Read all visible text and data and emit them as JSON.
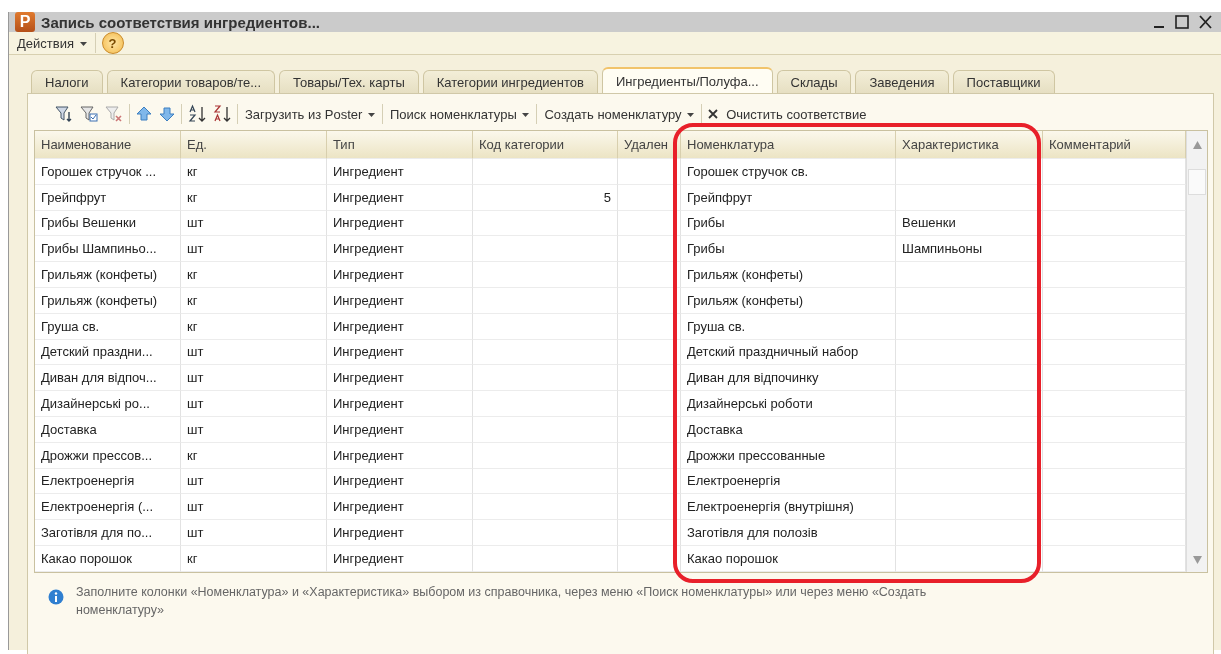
{
  "window": {
    "logo": "P",
    "title": "Запись соответствия ингредиентов..."
  },
  "menu": {
    "actions": "Действия",
    "help": "?"
  },
  "tabs": [
    {
      "label": "Налоги",
      "selected": false
    },
    {
      "label": "Категории товаров/те...",
      "selected": false
    },
    {
      "label": "Товары/Тех. карты",
      "selected": false
    },
    {
      "label": "Категории ингредиентов",
      "selected": false
    },
    {
      "label": "Ингредиенты/Полуфа...",
      "selected": true
    },
    {
      "label": "Склады",
      "selected": false
    },
    {
      "label": "Заведения",
      "selected": false
    },
    {
      "label": "Поставщики",
      "selected": false
    }
  ],
  "toolbar": {
    "load": "Загрузить из Poster",
    "search": "Поиск номенклатуры",
    "create": "Создать номенклатуру",
    "clear": "Очистить соответствие"
  },
  "table": {
    "columns": [
      "Наименование",
      "Ед.",
      "Тип",
      "Код категории",
      "Удален",
      "Номенклатура",
      "Характеристика",
      "Комментарий"
    ],
    "rows": [
      [
        "Горошек стручок ...",
        "кг",
        "Ингредиент",
        "",
        "",
        "Горошек стручок св.",
        "",
        ""
      ],
      [
        "Грейпфрут",
        "кг",
        "Ингредиент",
        "5",
        "",
        "Грейпфрут",
        "",
        ""
      ],
      [
        "Грибы Вешенки",
        "шт",
        "Ингредиент",
        "",
        "",
        "Грибы",
        "Вешенки",
        ""
      ],
      [
        "Грибы Шампиньо...",
        "шт",
        "Ингредиент",
        "",
        "",
        "Грибы",
        "Шампиньоны",
        ""
      ],
      [
        "Грильяж (конфеты)",
        "кг",
        "Ингредиент",
        "",
        "",
        "Грильяж (конфеты)",
        "",
        ""
      ],
      [
        "Грильяж (конфеты)",
        "кг",
        "Ингредиент",
        "",
        "",
        "Грильяж (конфеты)",
        "",
        ""
      ],
      [
        "Груша св.",
        "кг",
        "Ингредиент",
        "",
        "",
        "Груша св.",
        "",
        ""
      ],
      [
        "Детский праздни...",
        "шт",
        "Ингредиент",
        "",
        "",
        "Детский праздничный набор",
        "",
        ""
      ],
      [
        "Диван для відпоч...",
        "шт",
        "Ингредиент",
        "",
        "",
        "Диван для відпочинку",
        "",
        ""
      ],
      [
        "Дизайнерські ро...",
        "шт",
        "Ингредиент",
        "",
        "",
        "Дизайнерські роботи",
        "",
        ""
      ],
      [
        "Доставка",
        "шт",
        "Ингредиент",
        "",
        "",
        "Доставка",
        "",
        ""
      ],
      [
        "Дрожжи прессов...",
        "кг",
        "Ингредиент",
        "",
        "",
        "Дрожжи прессованные",
        "",
        ""
      ],
      [
        "Електроенергія",
        "шт",
        "Ингредиент",
        "",
        "",
        "Електроенергія",
        "",
        ""
      ],
      [
        "Електроенергія (...",
        "шт",
        "Ингредиент",
        "",
        "",
        "Електроенергія (внутрішня)",
        "",
        ""
      ],
      [
        "Заготівля для по...",
        "шт",
        "Ингредиент",
        "",
        "",
        "Заготівля для полозів",
        "",
        ""
      ],
      [
        "Какао порошок",
        "кг",
        "Ингредиент",
        "",
        "",
        "Какао порошок",
        "",
        ""
      ]
    ]
  },
  "hint": "Заполните колонки «Номенклатура» и «Характеристика» выбором из справочника, через меню «Поиск номенклатуры» или через меню «Создать номенклатуру»"
}
